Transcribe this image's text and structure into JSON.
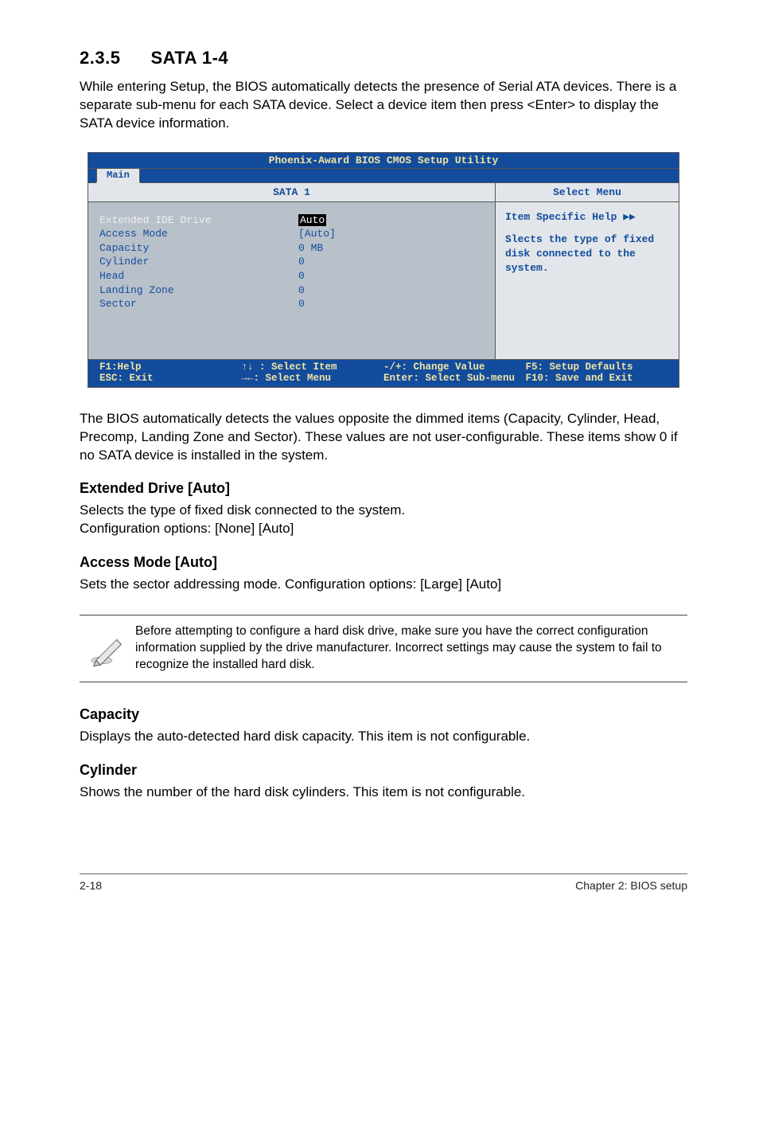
{
  "section": {
    "number": "2.3.5",
    "title": "SATA 1-4"
  },
  "intro": "While entering Setup, the BIOS automatically detects the presence of Serial ATA devices. There is a separate sub-menu for each SATA device. Select a device item then press <Enter> to display the SATA device information.",
  "bios": {
    "title": "Phoenix-Award BIOS CMOS Setup Utility",
    "tab": "Main",
    "left_header": "SATA 1",
    "right_header": "Select Menu",
    "rows": [
      {
        "label": "Extended IDE Drive",
        "value": "Auto",
        "hl_label": true,
        "inv_val": true
      },
      {
        "label": "Access Mode",
        "value": "[Auto]"
      },
      {
        "label": "",
        "value": ""
      },
      {
        "label": "Capacity",
        "value": "0 MB"
      },
      {
        "label": "",
        "value": ""
      },
      {
        "label": "Cylinder",
        "value": "0"
      },
      {
        "label": "Head",
        "value": "0"
      },
      {
        "label": "Landing Zone",
        "value": "0"
      },
      {
        "label": "Sector",
        "value": "0"
      }
    ],
    "help": {
      "head": "Item Specific Help ▶▶",
      "body": "Slects the type of fixed disk connected to the system."
    },
    "footer": {
      "c1a": "F1:Help",
      "c1b": "ESC: Exit",
      "c2a": "↑↓ : Select Item",
      "c2b": "→←: Select Menu",
      "c3a": "-/+: Change Value",
      "c3b": "Enter: Select Sub-menu",
      "c4a": "F5: Setup Defaults",
      "c4b": "F10: Save and Exit"
    }
  },
  "after_bios": "The BIOS automatically detects the values opposite the dimmed items (Capacity, Cylinder,  Head, Precomp, Landing Zone and Sector). These values are not user-configurable. These items show 0 if no SATA device is installed in the system.",
  "ext_drive": {
    "h": "Extended Drive [Auto]",
    "p1": "Selects the type of fixed disk connected to the system.",
    "p2": "Configuration options: [None] [Auto]"
  },
  "access_mode": {
    "h": "Access Mode [Auto]",
    "p": "Sets the sector addressing mode. Configuration options: [Large] [Auto]"
  },
  "note": "Before attempting to configure a hard disk drive, make sure you have the correct configuration information supplied by the drive manufacturer. Incorrect settings may cause the system to fail to recognize the installed hard disk.",
  "capacity": {
    "h": "Capacity",
    "p": "Displays the auto-detected hard disk capacity. This item is not configurable."
  },
  "cylinder": {
    "h": "Cylinder",
    "p": "Shows the number of the hard disk cylinders. This item is not configurable."
  },
  "footer": {
    "left": "2-18",
    "right": "Chapter 2: BIOS setup"
  }
}
